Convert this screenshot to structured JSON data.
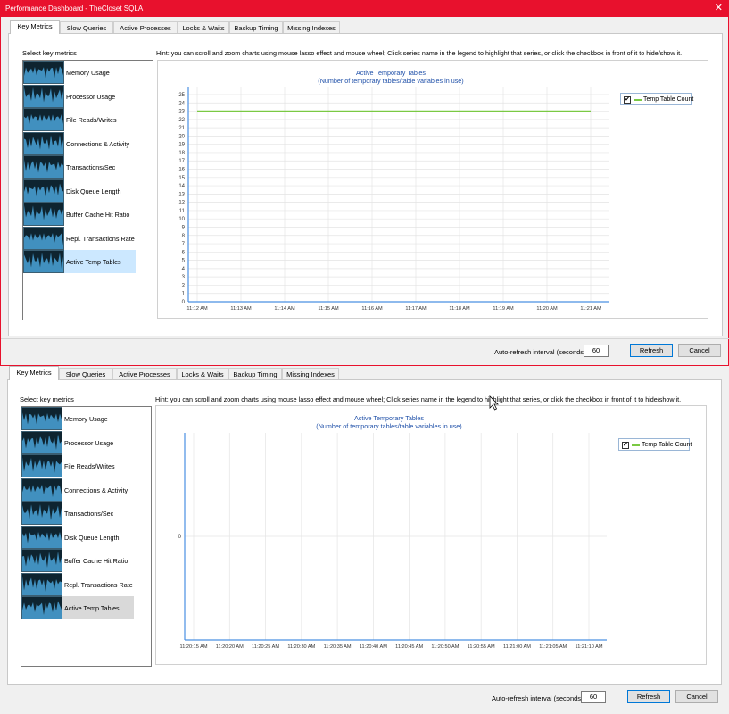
{
  "window": {
    "title": "Performance Dashboard - TheCloset SQLA",
    "close_glyph": "✕"
  },
  "tabs": [
    "Key Metrics",
    "Slow Queries",
    "Active Processes",
    "Locks & Waits",
    "Backup Timing",
    "Missing Indexes"
  ],
  "select_label": "Select  key metrics",
  "hint": "Hint: you can scroll and zoom charts using mouse lasso effect and mouse wheel; Click series name in the legend to highlight that series, or click the checkbox in front of it to hide/show it.",
  "metrics": [
    "Memory Usage",
    "Processor Usage",
    "File Reads/Writes",
    "Connections & Activity",
    "Transactions/Sec",
    "Disk Queue Length",
    "Buffer Cache Hit Ratio",
    "Repl. Transactions Rate",
    "Active Temp Tables"
  ],
  "chart": {
    "title": "Active Temporary Tables",
    "subtitle": "(Number of temporary tables/table variables in use)",
    "legend_check": "✔",
    "legend_label": "Temp Table Count"
  },
  "bottom": {
    "auto_refresh_label": "Auto-refresh interval (seconds):",
    "interval": "60",
    "refresh": "Refresh",
    "cancel": "Cancel"
  },
  "colors": {
    "accent": "#e8112d",
    "series": "#7ac943",
    "axis": "#4a90e2",
    "title": "#1e4fa8"
  },
  "chart_data": [
    {
      "type": "line",
      "title": "Active Temporary Tables",
      "subtitle": "(Number of temporary tables/table variables in use)",
      "x": [
        "11:12 AM",
        "11:13 AM",
        "11:14 AM",
        "11:15 AM",
        "11:16 AM",
        "11:17 AM",
        "11:18 AM",
        "11:19 AM",
        "11:20 AM",
        "11:21 AM"
      ],
      "y_ticks": [
        0,
        1,
        2,
        3,
        4,
        5,
        6,
        7,
        8,
        9,
        10,
        11,
        12,
        13,
        14,
        15,
        16,
        17,
        18,
        19,
        20,
        21,
        22,
        23,
        24,
        25
      ],
      "ylim": [
        0,
        25
      ],
      "series": [
        {
          "name": "Temp Table Count",
          "values": [
            23,
            23,
            23,
            23,
            23,
            23,
            23,
            23,
            23,
            23
          ]
        }
      ],
      "legend": "top-right",
      "grid": true
    },
    {
      "type": "line",
      "title": "Active Temporary Tables",
      "subtitle": "(Number of temporary tables/table variables in use)",
      "x": [
        "11:20:15 AM",
        "11:20:20 AM",
        "11:20:25 AM",
        "11:20:30 AM",
        "11:20:35 AM",
        "11:20:40 AM",
        "11:20:45 AM",
        "11:20:50 AM",
        "11:20:55 AM",
        "11:21:00 AM",
        "11:21:05 AM",
        "11:21:10 AM"
      ],
      "y_ticks": [
        0
      ],
      "series": [
        {
          "name": "Temp Table Count",
          "values": []
        }
      ],
      "legend": "top-right",
      "grid": true
    }
  ]
}
